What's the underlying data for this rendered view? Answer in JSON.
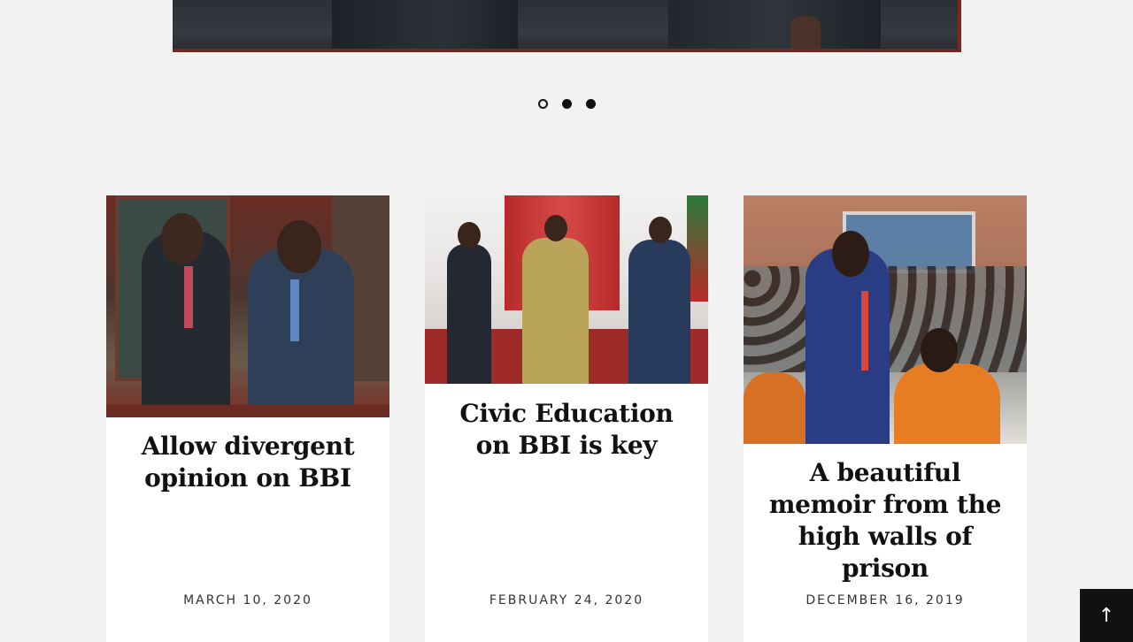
{
  "slider": {
    "dots": [
      {
        "state": "active"
      },
      {
        "state": "inactive"
      },
      {
        "state": "inactive"
      }
    ]
  },
  "posts": [
    {
      "title": "Allow divergent opinion on BBI",
      "date": "MARCH 10, 2020"
    },
    {
      "title": "Civic Education on BBI is key",
      "date": "FEBRUARY 24, 2020"
    },
    {
      "title": "A beautiful memoir from the high walls of prison",
      "date": "DECEMBER 16, 2019"
    }
  ],
  "back_to_top": {
    "icon": "arrow-up-icon",
    "glyph": "↑"
  }
}
